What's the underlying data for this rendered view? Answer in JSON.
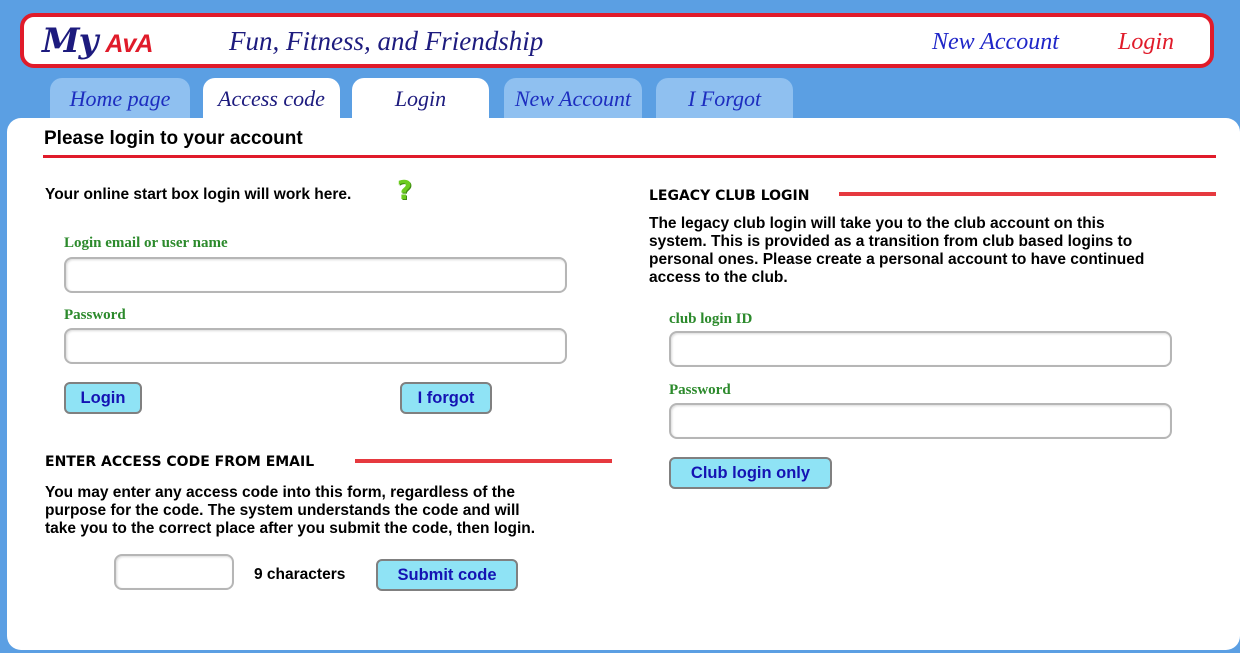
{
  "header": {
    "logo_my": "My",
    "logo_ava": "AvA",
    "tagline": "Fun, Fitness, and Friendship",
    "new_account": "New Account",
    "login": "Login"
  },
  "tabs": [
    {
      "label": "Home page",
      "active": false
    },
    {
      "label": "Access code",
      "active": true
    },
    {
      "label": "Login",
      "active": true
    },
    {
      "label": "New Account",
      "active": false
    },
    {
      "label": "I Forgot",
      "active": false
    }
  ],
  "page_title": "Please login to your account",
  "login_form": {
    "intro": "Your online start box login will work here.",
    "help_icon": "?",
    "email_label": "Login email or user name",
    "email_value": "",
    "password_label": "Password",
    "password_value": "",
    "login_button": "Login",
    "forgot_button": "I forgot"
  },
  "access_code": {
    "heading": "ENTER ACCESS CODE FROM EMAIL",
    "description_lines": [
      "You may enter any access code into this form, regardless of the",
      "purpose for the code. The system understands the code and will",
      "take you to the correct place after you submit the code, then login."
    ],
    "code_value": "",
    "characters_hint": "9 characters",
    "submit_button": "Submit code"
  },
  "legacy": {
    "heading": "LEGACY CLUB LOGIN",
    "description_lines": [
      "The legacy club login will take you to the club account on this",
      "system. This is provided as a transition from club based logins to",
      "personal ones. Please create a personal account to have continued",
      "access to the club."
    ],
    "club_id_label": "club login ID",
    "club_id_value": "",
    "password_label": "Password",
    "password_value": "",
    "club_login_button": "Club login only"
  },
  "colors": {
    "background": "#5b9fe3",
    "accent_red": "#e01b2a",
    "label_green": "#2c8a2c",
    "button_fill": "#8fe3f5",
    "button_text": "#1413b3"
  }
}
